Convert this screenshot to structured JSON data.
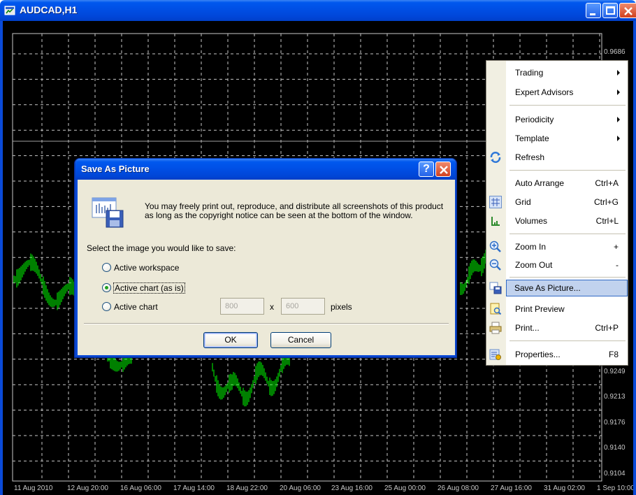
{
  "window": {
    "title": "AUDCAD,H1"
  },
  "chart": {
    "price_labels": [
      "0.9686",
      "0.9249",
      "0.9213",
      "0.9176",
      "0.9140",
      "0.9104"
    ],
    "date_labels": [
      "11 Aug 2010",
      "12 Aug 20:00",
      "16 Aug 06:00",
      "17 Aug 14:00",
      "18 Aug 22:00",
      "20 Aug 06:00",
      "23 Aug 16:00",
      "25 Aug 00:00",
      "26 Aug 08:00",
      "27 Aug 16:00",
      "31 Aug 02:00",
      "1 Sep 10:00"
    ],
    "bar_color": "#00ff00",
    "grid_color": "#c8c8c8",
    "background": "#000000"
  },
  "dialog": {
    "title": "Save As Picture",
    "help_label": "?",
    "message": "You may freely print out, reproduce, and distribute all screenshots of this product as long as the copyright notice can be seen at the bottom of the window.",
    "prompt": "Select the image you would like to save:",
    "options": [
      {
        "label": "Active workspace",
        "selected": false
      },
      {
        "label": "Active chart (as is)",
        "selected": true
      },
      {
        "label": "Active chart",
        "selected": false
      }
    ],
    "width_value": "800",
    "height_value": "600",
    "times_label": "x",
    "units_label": "pixels",
    "ok_label": "OK",
    "cancel_label": "Cancel"
  },
  "menu": {
    "items": [
      {
        "label": "Trading",
        "shortcut": "",
        "submenu": true,
        "icon": ""
      },
      {
        "label": "Expert Advisors",
        "shortcut": "",
        "submenu": true,
        "icon": ""
      },
      {
        "label": "Periodicity",
        "shortcut": "",
        "submenu": true,
        "icon": ""
      },
      {
        "label": "Template",
        "shortcut": "",
        "submenu": true,
        "icon": ""
      },
      {
        "label": "Refresh",
        "shortcut": "",
        "submenu": false,
        "icon": "refresh-icon"
      },
      {
        "label": "Auto Arrange",
        "shortcut": "Ctrl+A",
        "submenu": false,
        "icon": ""
      },
      {
        "label": "Grid",
        "shortcut": "Ctrl+G",
        "submenu": false,
        "icon": "grid-icon"
      },
      {
        "label": "Volumes",
        "shortcut": "Ctrl+L",
        "submenu": false,
        "icon": "volumes-icon"
      },
      {
        "label": "Zoom In",
        "shortcut": "+",
        "submenu": false,
        "icon": "zoom-in-icon"
      },
      {
        "label": "Zoom Out",
        "shortcut": "-",
        "submenu": false,
        "icon": "zoom-out-icon"
      },
      {
        "label": "Save As Picture...",
        "shortcut": "",
        "submenu": false,
        "icon": "save-picture-icon",
        "highlighted": true
      },
      {
        "label": "Print Preview",
        "shortcut": "",
        "submenu": false,
        "icon": "print-preview-icon"
      },
      {
        "label": "Print...",
        "shortcut": "Ctrl+P",
        "submenu": false,
        "icon": "printer-icon"
      },
      {
        "label": "Properties...",
        "shortcut": "F8",
        "submenu": false,
        "icon": "properties-icon"
      }
    ]
  }
}
